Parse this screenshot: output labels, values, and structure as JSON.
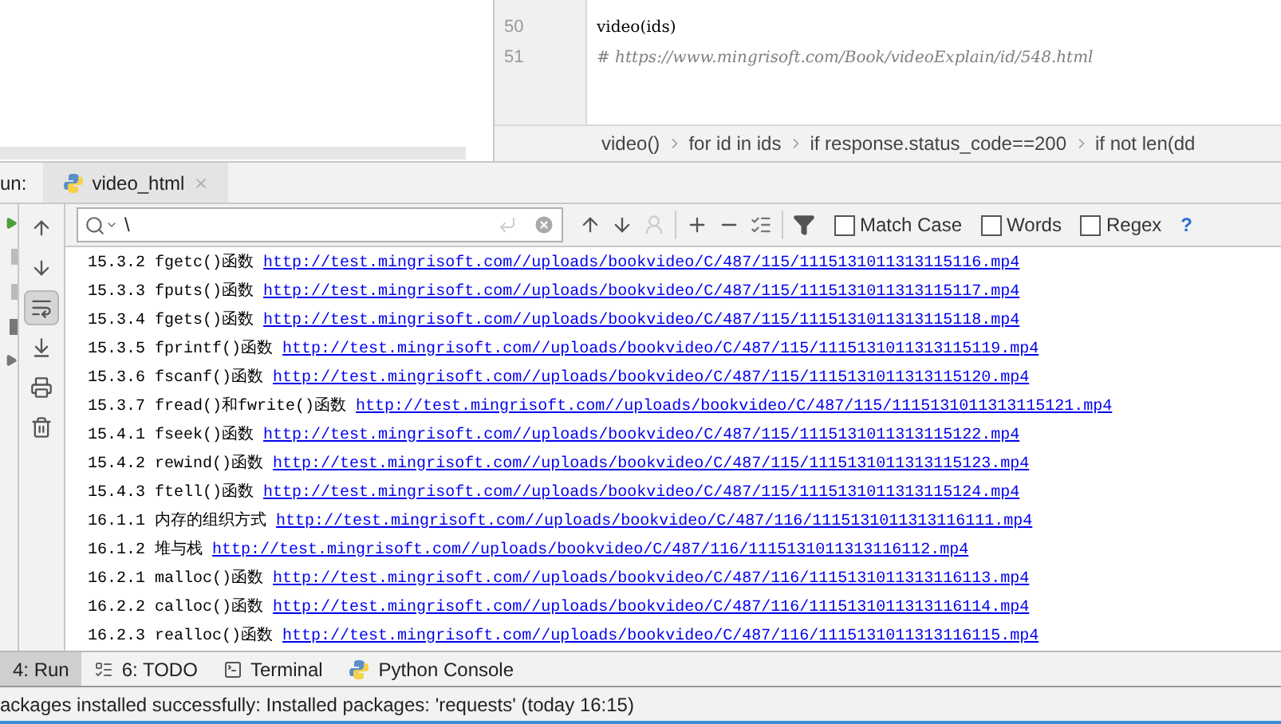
{
  "editor": {
    "lines": [
      {
        "number": "50",
        "kind": "code",
        "text": "video(ids)"
      },
      {
        "number": "51",
        "kind": "comment",
        "text": "# https://www.mingrisoft.com/Book/videoExplain/id/548.html"
      }
    ],
    "breadcrumbs": [
      "video()",
      "for id in ids",
      "if response.status_code==200",
      "if not len(dd"
    ]
  },
  "run_panel": {
    "label": "un:",
    "tab": {
      "title": "video_html"
    },
    "soft_wrap_on": true
  },
  "search": {
    "value": "\\",
    "options": [
      {
        "label": "Match Case",
        "checked": false
      },
      {
        "label": "Words",
        "checked": false
      },
      {
        "label": "Regex",
        "checked": false
      }
    ],
    "help": "?"
  },
  "output": [
    {
      "number": "15.3.2",
      "title": "fgetc()函数",
      "link": "http://test.mingrisoft.com//uploads/bookvideo/C/487/115/1115131011313115116.mp4"
    },
    {
      "number": "15.3.3",
      "title": "fputs()函数",
      "link": "http://test.mingrisoft.com//uploads/bookvideo/C/487/115/1115131011313115117.mp4"
    },
    {
      "number": "15.3.4",
      "title": "fgets()函数",
      "link": "http://test.mingrisoft.com//uploads/bookvideo/C/487/115/1115131011313115118.mp4"
    },
    {
      "number": "15.3.5",
      "title": "fprintf()函数",
      "link": "http://test.mingrisoft.com//uploads/bookvideo/C/487/115/1115131011313115119.mp4"
    },
    {
      "number": "15.3.6",
      "title": "fscanf()函数",
      "link": "http://test.mingrisoft.com//uploads/bookvideo/C/487/115/1115131011313115120.mp4"
    },
    {
      "number": "15.3.7",
      "title": "fread()和fwrite()函数",
      "link": "http://test.mingrisoft.com//uploads/bookvideo/C/487/115/1115131011313115121.mp4"
    },
    {
      "number": "15.4.1",
      "title": "fseek()函数",
      "link": "http://test.mingrisoft.com//uploads/bookvideo/C/487/115/1115131011313115122.mp4"
    },
    {
      "number": "15.4.2",
      "title": "rewind()函数",
      "link": "http://test.mingrisoft.com//uploads/bookvideo/C/487/115/1115131011313115123.mp4"
    },
    {
      "number": "15.4.3",
      "title": "ftell()函数",
      "link": "http://test.mingrisoft.com//uploads/bookvideo/C/487/115/1115131011313115124.mp4"
    },
    {
      "number": "16.1.1",
      "title": "内存的组织方式",
      "link": "http://test.mingrisoft.com//uploads/bookvideo/C/487/116/1115131011313116111.mp4"
    },
    {
      "number": "16.1.2",
      "title": "堆与栈",
      "link": "http://test.mingrisoft.com//uploads/bookvideo/C/487/116/1115131011313116112.mp4"
    },
    {
      "number": "16.2.1",
      "title": "malloc()函数",
      "link": "http://test.mingrisoft.com//uploads/bookvideo/C/487/116/1115131011313116113.mp4"
    },
    {
      "number": "16.2.2",
      "title": "calloc()函数",
      "link": "http://test.mingrisoft.com//uploads/bookvideo/C/487/116/1115131011313116114.mp4"
    },
    {
      "number": "16.2.3",
      "title": "realloc()函数",
      "link": "http://test.mingrisoft.com//uploads/bookvideo/C/487/116/1115131011313116115.mp4"
    }
  ],
  "tool_tabs": [
    {
      "label": "4: Run",
      "kind": "run",
      "selected": true
    },
    {
      "label": "6: TODO",
      "kind": "todo",
      "selected": false
    },
    {
      "label": "Terminal",
      "kind": "terminal",
      "selected": false
    },
    {
      "label": "Python Console",
      "kind": "python",
      "selected": false
    }
  ],
  "status_bar": "ackages installed successfully: Installed packages: 'requests' (today 16:15)"
}
